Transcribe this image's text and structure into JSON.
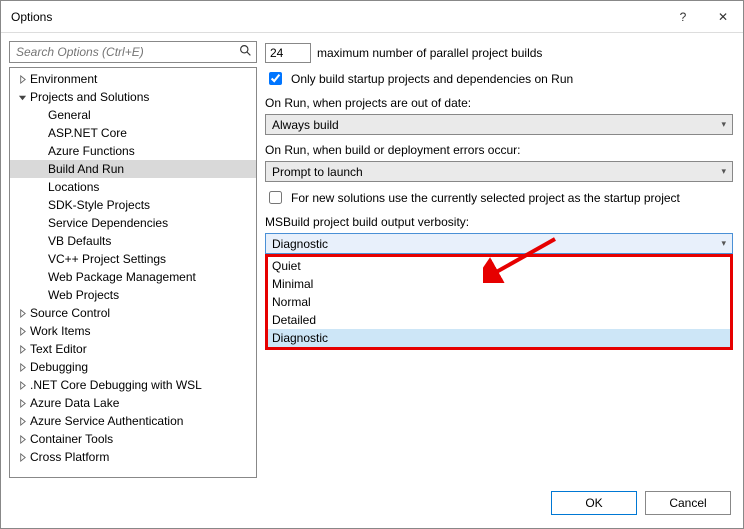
{
  "window": {
    "title": "Options",
    "help_btn": "?",
    "close_btn": "✕"
  },
  "search": {
    "placeholder": "Search Options (Ctrl+E)"
  },
  "tree": [
    {
      "indent": 0,
      "exp": "collapsed",
      "label": "Environment"
    },
    {
      "indent": 0,
      "exp": "expanded",
      "label": "Projects and Solutions"
    },
    {
      "indent": 1,
      "exp": "none",
      "label": "General"
    },
    {
      "indent": 1,
      "exp": "none",
      "label": "ASP.NET Core"
    },
    {
      "indent": 1,
      "exp": "none",
      "label": "Azure Functions"
    },
    {
      "indent": 1,
      "exp": "none",
      "label": "Build And Run",
      "selected": true
    },
    {
      "indent": 1,
      "exp": "none",
      "label": "Locations"
    },
    {
      "indent": 1,
      "exp": "none",
      "label": "SDK-Style Projects"
    },
    {
      "indent": 1,
      "exp": "none",
      "label": "Service Dependencies"
    },
    {
      "indent": 1,
      "exp": "none",
      "label": "VB Defaults"
    },
    {
      "indent": 1,
      "exp": "none",
      "label": "VC++ Project Settings"
    },
    {
      "indent": 1,
      "exp": "none",
      "label": "Web Package Management"
    },
    {
      "indent": 1,
      "exp": "none",
      "label": "Web Projects"
    },
    {
      "indent": 0,
      "exp": "collapsed",
      "label": "Source Control"
    },
    {
      "indent": 0,
      "exp": "collapsed",
      "label": "Work Items"
    },
    {
      "indent": 0,
      "exp": "collapsed",
      "label": "Text Editor"
    },
    {
      "indent": 0,
      "exp": "collapsed",
      "label": "Debugging"
    },
    {
      "indent": 0,
      "exp": "collapsed",
      "label": ".NET Core Debugging with WSL"
    },
    {
      "indent": 0,
      "exp": "collapsed",
      "label": "Azure Data Lake"
    },
    {
      "indent": 0,
      "exp": "collapsed",
      "label": "Azure Service Authentication"
    },
    {
      "indent": 0,
      "exp": "collapsed",
      "label": "Container Tools"
    },
    {
      "indent": 0,
      "exp": "collapsed",
      "label": "Cross Platform"
    }
  ],
  "settings": {
    "parallel_count": "24",
    "parallel_label": "maximum number of parallel project builds",
    "startup_only_checked": true,
    "startup_only_label": "Only build startup projects and dependencies on Run",
    "on_run_out_of_date_label": "On Run, when projects are out of date:",
    "on_run_out_of_date_value": "Always build",
    "on_run_errors_label": "On Run, when build or deployment errors occur:",
    "on_run_errors_value": "Prompt to launch",
    "new_solution_startup_checked": false,
    "new_solution_startup_label": "For new solutions use the currently selected project as the startup project",
    "verbosity_label": "MSBuild project build output verbosity:",
    "verbosity_value": "Diagnostic",
    "verbosity_options": [
      "Quiet",
      "Minimal",
      "Normal",
      "Detailed",
      "Diagnostic"
    ],
    "verbosity_highlight_index": 4
  },
  "footer": {
    "ok": "OK",
    "cancel": "Cancel"
  }
}
